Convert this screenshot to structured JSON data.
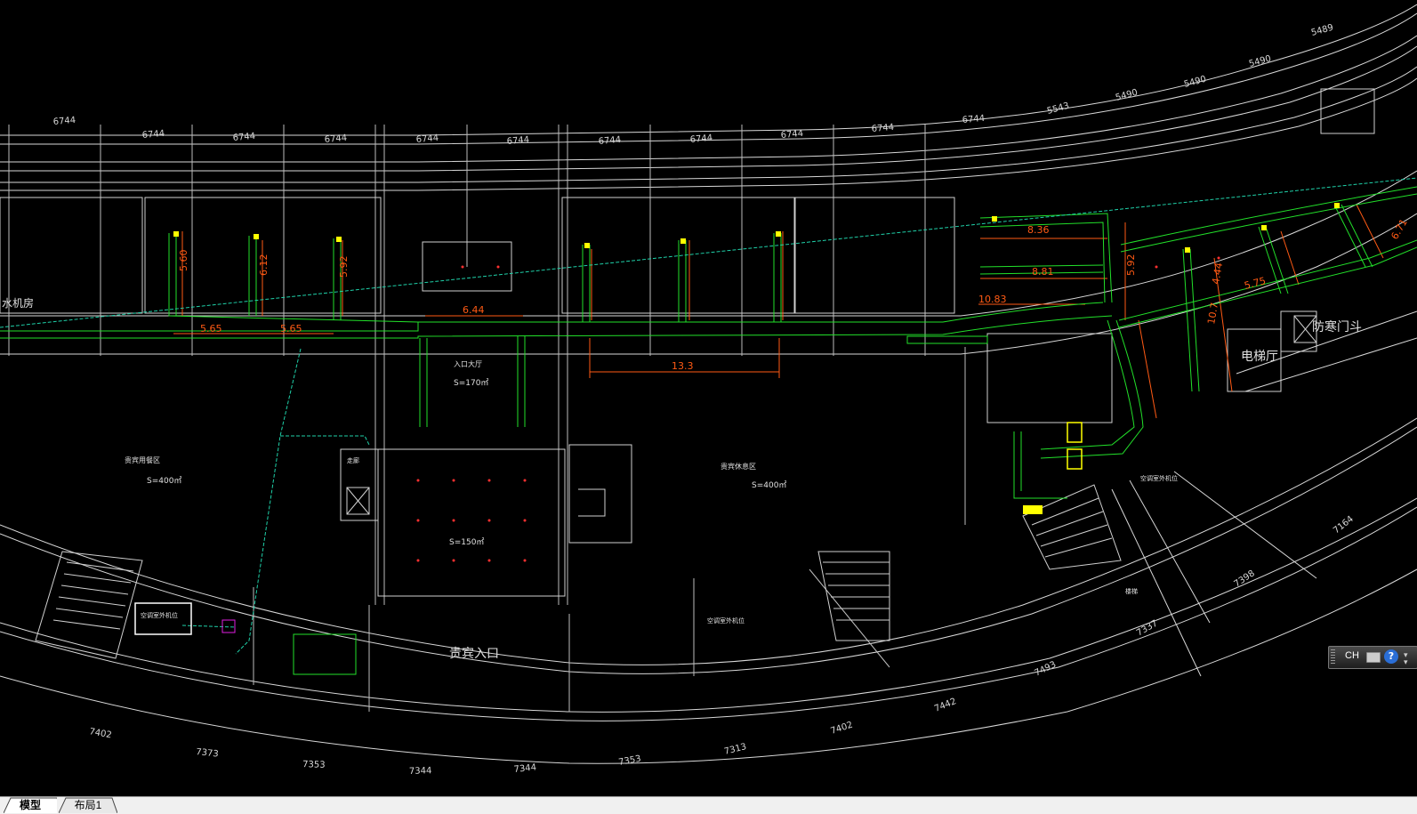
{
  "tabs": {
    "model": "模型",
    "layout1": "布局1"
  },
  "language_bar": {
    "lang": "CH",
    "keyboard_icon": "keyboard-icon",
    "help_icon": "help-icon",
    "help_glyph": "?"
  },
  "colors": {
    "background": "#000000",
    "line_white": "#d8d8d8",
    "duct_green": "#22e02a",
    "dim_orange": "#ff5a14",
    "pipe_cyan": "#1fd0a8",
    "equip_yellow": "#ffff00",
    "pipe_magenta": "#e01ee0"
  },
  "drawing": {
    "top_axis_dims": [
      "6744",
      "6744",
      "6744",
      "6744",
      "6744",
      "6744",
      "6744",
      "6744",
      "6744",
      "6744",
      "6744",
      "5543",
      "5490",
      "5490",
      "5490",
      "5489"
    ],
    "bottom_axis_dims": [
      "7402",
      "7373",
      "7353",
      "7344",
      "7344",
      "7353",
      "7313",
      "7402",
      "7442",
      "7493",
      "7337",
      "7398",
      "7164"
    ],
    "rooms": {
      "guest_dining": "贵宾用餐区",
      "area_400a": "S=400㎡",
      "area_400b": "S=400㎡",
      "area_170": "S=170㎡",
      "area_150": "S=150㎡",
      "entry_hall": "入口大厅",
      "vip_lounge": "贵宾休息区",
      "vip_entrance": "贵宾入口",
      "elevator_hall": "电梯厅",
      "anti_door": "防寒门斗",
      "machine_room": "水机房",
      "ac_outdoor_1": "空调室外机位",
      "ac_outdoor_2": "空调室外机位",
      "ac_outdoor_3": "空调室外机位",
      "stair": "楼梯",
      "corridor": "走廊"
    },
    "duct_dims": [
      "6.44",
      "13.3",
      "8.36",
      "8.81",
      "10.83",
      "5.65",
      "5.65",
      "5.60",
      "6.12",
      "5.92",
      "5.92",
      "4.44",
      "5.75",
      "10.7",
      "6.71"
    ]
  }
}
